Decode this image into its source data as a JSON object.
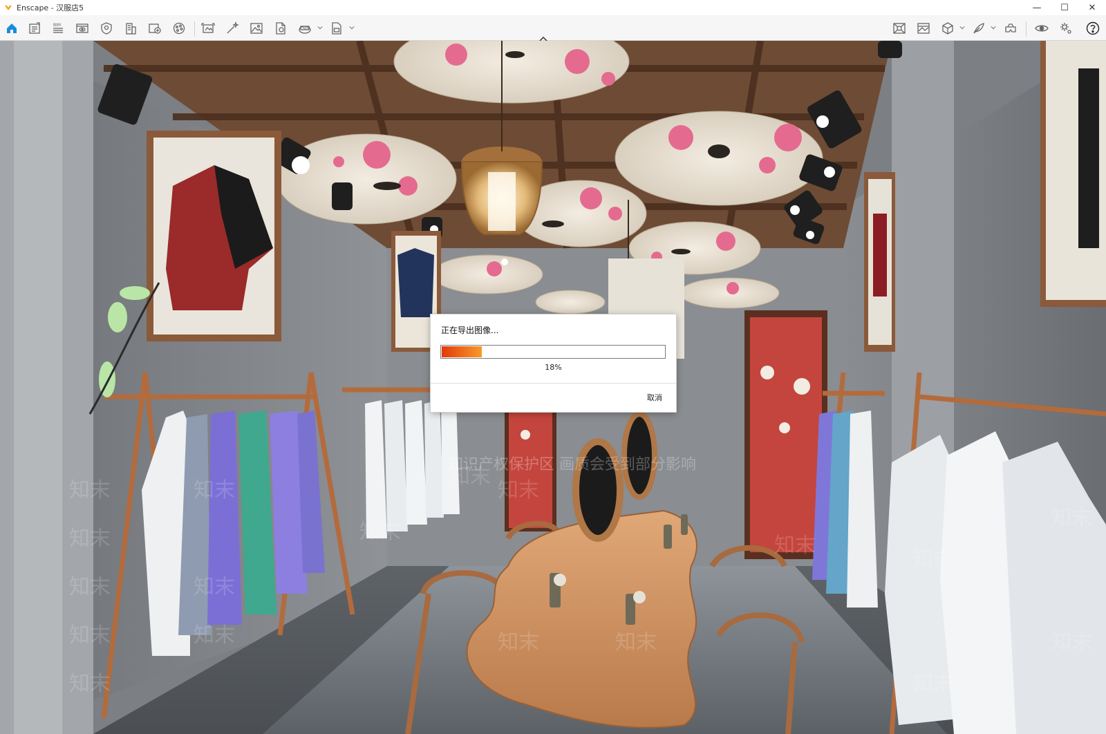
{
  "window": {
    "title": "Enscape - 汉服店5",
    "minimize_glyph": "—",
    "maximize_glyph": "☐",
    "close_glyph": "✕"
  },
  "toolbar": {
    "left_tools": [
      {
        "name": "home-icon"
      },
      {
        "name": "document-icon"
      },
      {
        "name": "bim-icon",
        "label": "BIM"
      },
      {
        "name": "view-icon"
      },
      {
        "name": "shield-icon"
      },
      {
        "name": "building-icon"
      },
      {
        "name": "image-add-icon"
      },
      {
        "name": "palette-icon"
      },
      {
        "name": "screenshot-icon"
      },
      {
        "name": "magic-wand-icon"
      },
      {
        "name": "image-icon"
      },
      {
        "name": "file-export-icon"
      },
      {
        "name": "panorama-icon"
      },
      {
        "name": "batch-render-icon"
      }
    ],
    "right_tools": [
      {
        "name": "material-icon"
      },
      {
        "name": "settings-image-icon"
      },
      {
        "name": "cube-icon"
      },
      {
        "name": "feather-icon"
      },
      {
        "name": "vr-headset-icon"
      },
      {
        "name": "eye-icon"
      },
      {
        "name": "gears-icon"
      },
      {
        "name": "help-icon"
      }
    ],
    "accent": "#1a8cdb"
  },
  "dialog": {
    "title": "正在导出图像...",
    "progress_percent": 18,
    "progress_label": "18%",
    "cancel_label": "取消",
    "fill_colors": [
      "#e23a08",
      "#f79a2c"
    ]
  },
  "watermark": {
    "notice": "知识产权保护区  画质会受到部分影响",
    "brand": "知末"
  }
}
